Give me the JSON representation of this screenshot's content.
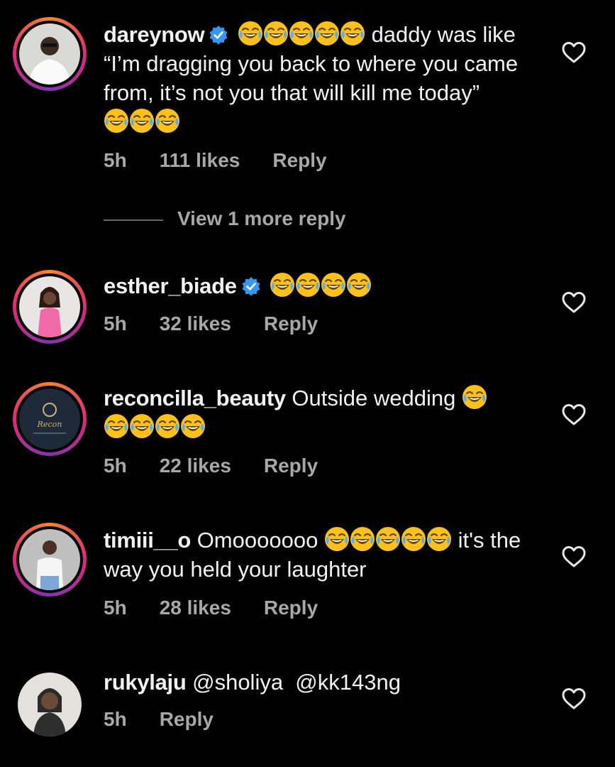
{
  "emoji_name": "face-with-tears-of-joy",
  "colors": {
    "background": "#000000",
    "meta": "#a8a8a8",
    "verified": "#3797f0",
    "emoji_yellow": "#fcc21b"
  },
  "comments": [
    {
      "username": "dareynow",
      "verified": true,
      "lead_emoji_count": 5,
      "text_a": "daddy was like “I’m dragging you back to where you came from, it’s not you that will kill me today”",
      "trail_emoji_count": 3,
      "time": "5h",
      "likes": "111 likes",
      "reply": "Reply",
      "has_story_ring": true
    },
    {
      "username": "esther_biade",
      "verified": true,
      "lead_emoji_count": 4,
      "time": "5h",
      "likes": "32 likes",
      "reply": "Reply",
      "has_story_ring": true
    },
    {
      "username": "reconcilla_beauty",
      "text_a": "Outside wedding",
      "trail_emoji_count": 5,
      "time": "5h",
      "likes": "22 likes",
      "reply": "Reply",
      "has_story_ring": true,
      "avatar_logo_text": "Recon"
    },
    {
      "username": "timiii__o",
      "text_a": "Omooooooo",
      "mid_emoji_count": 5,
      "text_b": "it's the way you held your laughter",
      "time": "5h",
      "likes": "28 likes",
      "reply": "Reply",
      "has_story_ring": true
    },
    {
      "username": "rukylaju",
      "text_a": "@sholiya  @kk143ng",
      "time": "5h",
      "reply": "Reply",
      "has_story_ring": false
    }
  ],
  "view_more_replies": "View 1 more reply"
}
